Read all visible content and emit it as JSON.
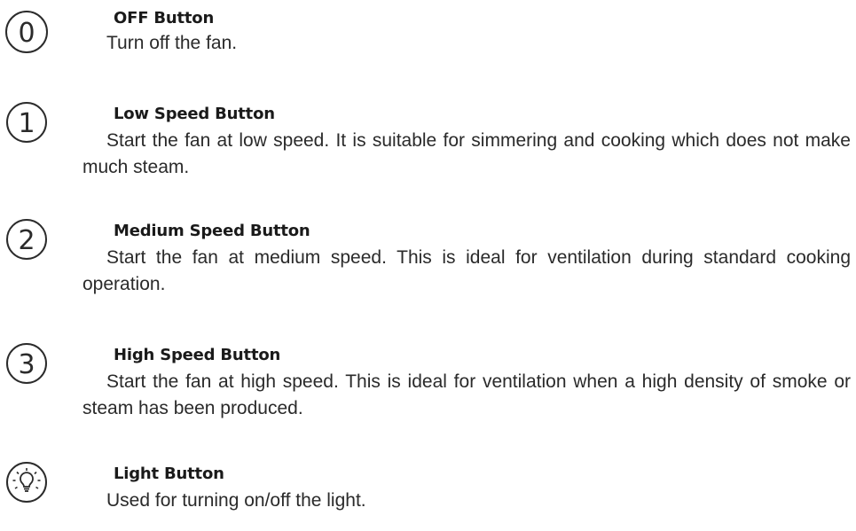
{
  "buttons": [
    {
      "symbol": "0",
      "icon": "power-off-icon",
      "title": "OFF Button",
      "description": "Turn off the fan."
    },
    {
      "symbol": "1",
      "icon": "number-1-icon",
      "title": "Low Speed Button",
      "description": "Start the fan at low speed. It is suitable for simmering and cooking which does not make much steam."
    },
    {
      "symbol": "2",
      "icon": "number-2-icon",
      "title": "Medium Speed Button",
      "description": "Start the fan at medium speed. This is ideal for ventilation during standard cooking operation."
    },
    {
      "symbol": "3",
      "icon": "number-3-icon",
      "title": "High Speed Button",
      "description": "Start the fan at high speed. This is ideal for ventilation when a high density of smoke or steam has been produced."
    },
    {
      "symbol": "",
      "icon": "light-bulb-icon",
      "title": "Light Button",
      "description": "Used for turning on/off the light."
    }
  ],
  "colors": {
    "text": "#1d1d1d",
    "icon_stroke": "#2b2b2b"
  }
}
